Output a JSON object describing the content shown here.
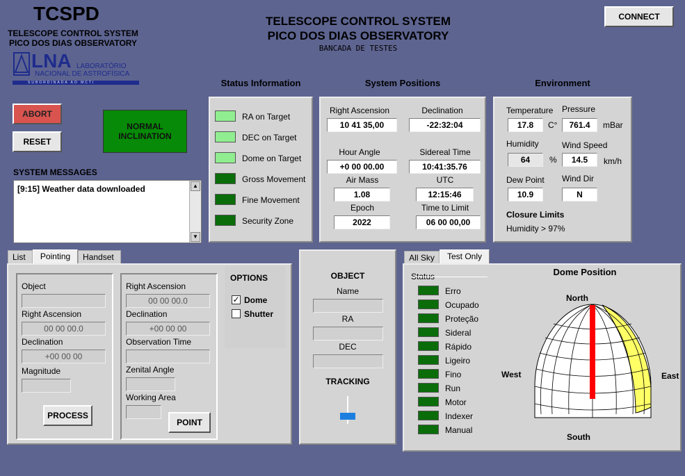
{
  "brand": {
    "title": "TCSPD",
    "line1": "TELESCOPE CONTROL SYSTEM",
    "line2": "PICO DOS DIAS OBSERVATORY",
    "logo_letters": "LNA",
    "logo_line1": "LABORATÓRIO",
    "logo_line2": "NACIONAL DE ASTROFÍSICA",
    "logo_tag": "SUBORDINADA AO MCTI"
  },
  "header": {
    "title1": "TELESCOPE CONTROL SYSTEM",
    "title2": "PICO DOS DIAS OBSERVATORY",
    "subtitle": "BANCADA DE TESTES",
    "connect": "CONNECT"
  },
  "controls": {
    "abort": "ABORT",
    "reset": "RESET",
    "inclination_line1": "NORMAL",
    "inclination_line2": "INCLINATION",
    "inclination_color": "#078a07"
  },
  "messages": {
    "label": "SYSTEM MESSAGES",
    "text": "[9:15] Weather data downloaded"
  },
  "status": {
    "title": "Status Information",
    "items": [
      {
        "label": "RA on Target",
        "state": "on"
      },
      {
        "label": "DEC on Target",
        "state": "on"
      },
      {
        "label": "Dome on Target",
        "state": "on"
      },
      {
        "label": "Gross Movement",
        "state": "off"
      },
      {
        "label": "Fine Movement",
        "state": "off"
      },
      {
        "label": "Security Zone",
        "state": "off"
      }
    ]
  },
  "positions": {
    "title": "System Positions",
    "ra_label": "Right Ascension",
    "ra": "10 41 35,00",
    "dec_label": "Declination",
    "dec": "-22:32:04",
    "ha_label": "Hour Angle",
    "ha": "+0 00 00.00",
    "st_label": "Sidereal Time",
    "st": "10:41:35.76",
    "airmass_label": "Air Mass",
    "airmass": "1.08",
    "utc_label": "UTC",
    "utc": "12:15:46",
    "epoch_label": "Epoch",
    "epoch": "2022",
    "ttl_label": "Time to Limit",
    "ttl": "06 00 00,00"
  },
  "environment": {
    "title": "Environment",
    "temp_label": "Temperature",
    "temp": "17.8",
    "temp_unit": "C°",
    "pressure_label": "Pressure",
    "pressure": "761.4",
    "pressure_unit": "mBar",
    "humidity_label": "Humidity",
    "humidity": "64",
    "humidity_unit": "%",
    "wind_label": "Wind Speed",
    "wind": "14.5",
    "wind_unit": "km/h",
    "dew_label": "Dew Point",
    "dew": "10.9",
    "winddir_label": "Wind Dir",
    "winddir": "N",
    "closure_title": "Closure Limits",
    "closure_text": "Humidity > 97%"
  },
  "tabs": [
    "List",
    "Pointing",
    "Handset"
  ],
  "pointing": {
    "object_label": "Object",
    "ra_label": "Right Ascension",
    "ra_value": "00 00 00.0",
    "dec_label": "Declination",
    "dec_value": "+00 00 00",
    "mag_label": "Magnitude",
    "process": "PROCESS",
    "ra2_label": "Right Ascension",
    "ra2_value": "00 00 00.0",
    "dec2_label": "Declination",
    "dec2_value": "+00 00 00",
    "obs_label": "Observation Time",
    "zen_label": "Zenital Angle",
    "work_label": "Working Area",
    "point": "POINT",
    "options_title": "OPTIONS",
    "opt_dome": "Dome",
    "opt_dome_checked": "✓",
    "opt_shutter": "Shutter"
  },
  "object_panel": {
    "title": "OBJECT",
    "name_label": "Name",
    "ra_label": "RA",
    "dec_label": "DEC",
    "tracking": "TRACKING",
    "tracking_level": 0.2
  },
  "dome_tabs": [
    "All Sky",
    "Test Only"
  ],
  "dome": {
    "status_label": "Status",
    "items": [
      "Erro",
      "Ocupado",
      "Proteção",
      "Sideral",
      "Rápido",
      "Ligeiro",
      "Fino",
      "Run",
      "Motor",
      "Indexer",
      "Manual"
    ],
    "title": "Dome Position",
    "north": "North",
    "south": "South",
    "west": "West",
    "east": "East"
  }
}
